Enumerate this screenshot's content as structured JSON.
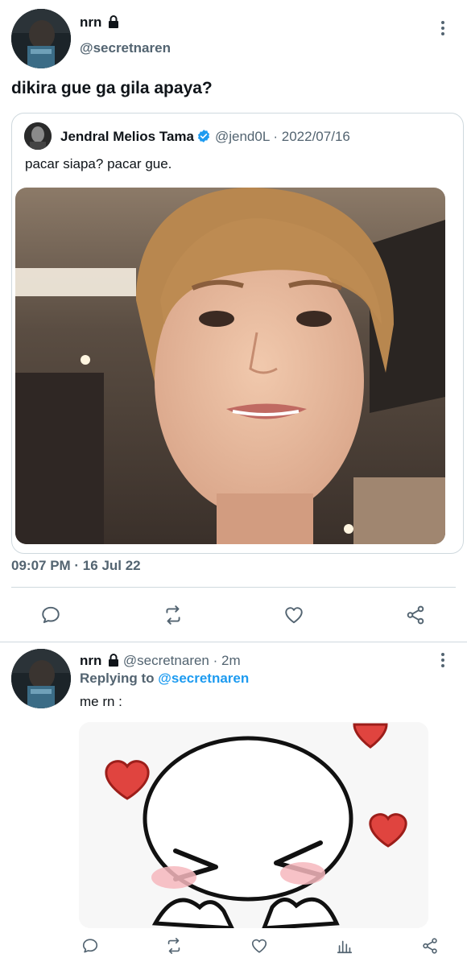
{
  "main_tweet": {
    "display_name": "nrn",
    "handle": "@secretnaren",
    "text": "dikira gue ga gila apaya?",
    "timestamp": "09:07 PM · 16 Jul 22",
    "icons": {
      "lock": "lock-icon",
      "more": "more-vertical-icon",
      "reply": "reply-icon",
      "retweet": "retweet-icon",
      "like": "heart-icon",
      "share": "share-icon"
    }
  },
  "quoted_tweet": {
    "display_name": "Jendral Melios Tama",
    "handle": "@jend0L",
    "separator": " · ",
    "date": "2022/07/16",
    "text": "pacar siapa? pacar gue.",
    "verified_color": "#1d9bf0"
  },
  "reply_tweet": {
    "display_name": "nrn",
    "handle": "@secretnaren",
    "time": "2m",
    "separator": " · ",
    "replying_prefix": "Replying to",
    "replying_to": "@secretnaren",
    "text": "me rn :",
    "icons": {
      "reply": "reply-icon",
      "retweet": "retweet-icon",
      "like": "heart-icon",
      "analytics": "analytics-icon",
      "share": "share-icon"
    }
  },
  "colors": {
    "text": "#0f1419",
    "secondary": "#536471",
    "link": "#1d9bf0",
    "border": "#cfd9de"
  }
}
